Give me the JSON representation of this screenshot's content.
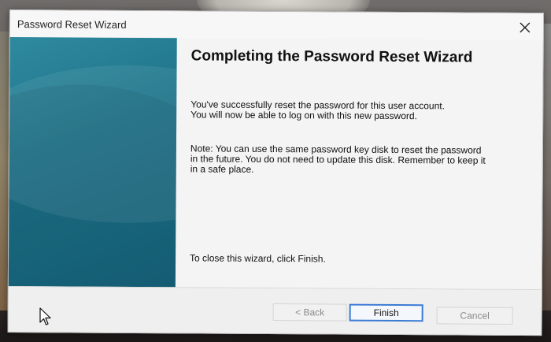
{
  "window": {
    "title": "Password Reset Wizard",
    "close_icon": "close-icon"
  },
  "main": {
    "heading": "Completing the Password Reset Wizard",
    "paragraph1": "You've successfully reset the password for this user account. You will now be able to log on with this new password.",
    "paragraph2": "Note: You can use the same password key disk to reset the password in the future. You do not need to update this disk. Remember to keep it in a safe place.",
    "closing_text": "To close this wizard, click Finish."
  },
  "buttons": {
    "back": "< Back",
    "finish": "Finish",
    "cancel": "Cancel"
  },
  "colors": {
    "side_panel": "#1e7389",
    "finish_border": "#3b7bd3"
  }
}
